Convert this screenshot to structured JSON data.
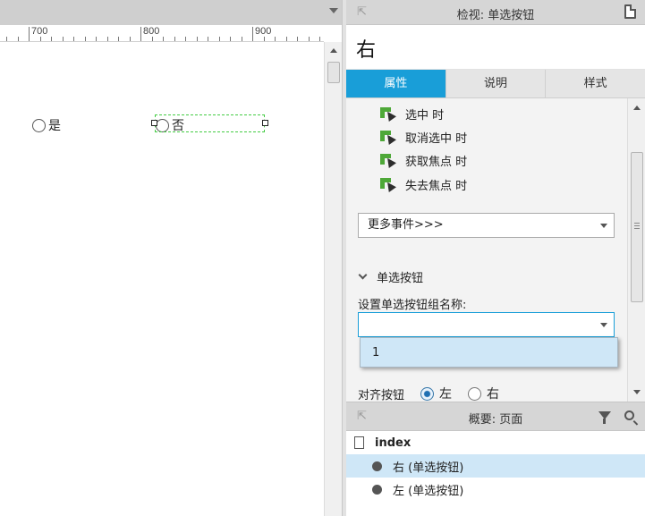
{
  "canvas": {
    "ruler_labels": [
      "700",
      "800",
      "900"
    ],
    "radio_yes_label": "是",
    "radio_no_label": "否"
  },
  "inspector": {
    "title": "检视: 单选按钮",
    "widget_name": "右",
    "tabs": [
      {
        "label": "属性",
        "active": true
      },
      {
        "label": "说明",
        "active": false
      },
      {
        "label": "样式",
        "active": false
      }
    ],
    "events": [
      "选中 时",
      "取消选中 时",
      "获取焦点 时",
      "失去焦点 时"
    ],
    "more_events": "更多事件>>>",
    "section_title": "单选按钮",
    "group_name_label": "设置单选按钮组名称:",
    "group_name_value": "",
    "group_name_options": [
      "1"
    ],
    "align_label": "对齐按钮",
    "align_left": "左",
    "align_right": "右",
    "align_selected": "左"
  },
  "outline": {
    "title": "概要: 页面",
    "page": "index",
    "items": [
      {
        "label": "右 (单选按钮)",
        "selected": true
      },
      {
        "label": "左 (单选按钮)",
        "selected": false
      }
    ]
  },
  "colors": {
    "accent": "#199ed8",
    "selection_bg": "#cfe7f7",
    "event_icon": "#4ea838",
    "selection_border": "#44cc44"
  }
}
